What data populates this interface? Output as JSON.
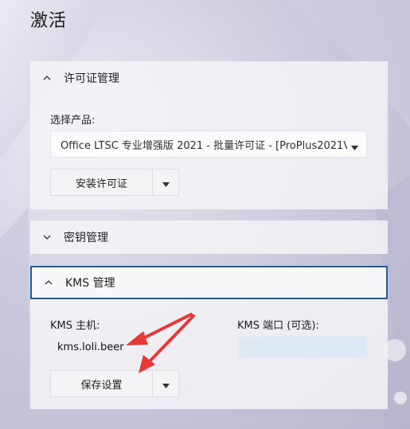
{
  "page": {
    "title": "激活"
  },
  "license_section": {
    "header": "许可证管理",
    "product_label": "选择产品:",
    "product_value": "Office LTSC 专业增强版 2021 - 批量许可证 - [ProPlus2021Vol...",
    "install_button": "安装许可证"
  },
  "key_section": {
    "header": "密钥管理"
  },
  "kms_section": {
    "header": "KMS 管理",
    "host_label": "KMS 主机:",
    "host_value": "kms.loli.beer",
    "port_label": "KMS 端口 (可选):",
    "port_value": "",
    "save_button": "保存设置"
  },
  "colors": {
    "accent_border": "#1f5fa0",
    "arrow_red": "#e53935",
    "port_field": "#dfe8f5"
  }
}
